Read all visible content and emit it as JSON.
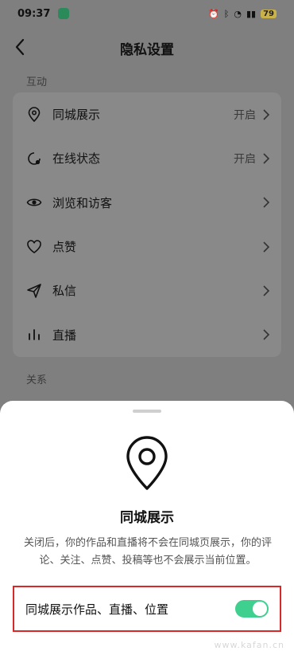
{
  "status_bar": {
    "time": "09:37",
    "battery": "79"
  },
  "header": {
    "title": "隐私设置"
  },
  "sections": {
    "interaction_label": "互动",
    "relations_label": "关系"
  },
  "rows": [
    {
      "label": "同城展示",
      "value": "开启",
      "icon": "location-pin-icon"
    },
    {
      "label": "在线状态",
      "value": "开启",
      "icon": "online-status-icon"
    },
    {
      "label": "浏览和访客",
      "value": "",
      "icon": "eye-icon"
    },
    {
      "label": "点赞",
      "value": "",
      "icon": "heart-icon"
    },
    {
      "label": "私信",
      "value": "",
      "icon": "send-icon"
    },
    {
      "label": "直播",
      "value": "",
      "icon": "live-bars-icon"
    }
  ],
  "sheet": {
    "title": "同城展示",
    "description": "关闭后，你的作品和直播将不会在同城页展示，你的评论、关注、点赞、投稿等也不会展示当前位置。",
    "toggle_label": "同城展示作品、直播、位置",
    "toggle_on": true
  },
  "watermark": "www.kafan.cn",
  "colors": {
    "switch_on": "#3fcf8e",
    "highlight_border": "#d62a2a"
  }
}
